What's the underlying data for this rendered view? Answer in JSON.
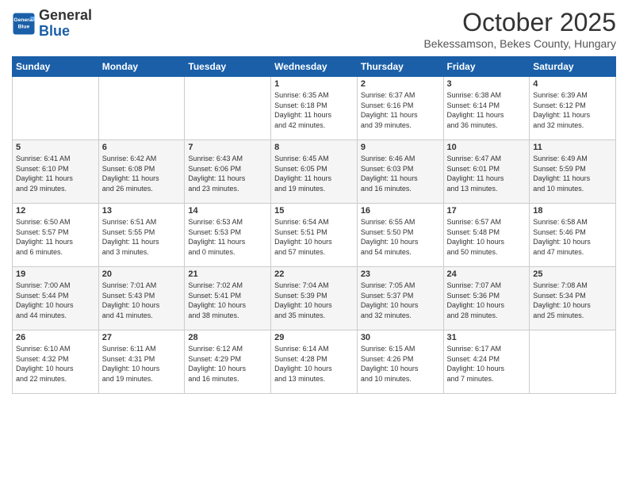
{
  "header": {
    "logo_general": "General",
    "logo_blue": "Blue",
    "month": "October 2025",
    "location": "Bekessamson, Bekes County, Hungary"
  },
  "days_of_week": [
    "Sunday",
    "Monday",
    "Tuesday",
    "Wednesday",
    "Thursday",
    "Friday",
    "Saturday"
  ],
  "weeks": [
    [
      {
        "day": "",
        "info": ""
      },
      {
        "day": "",
        "info": ""
      },
      {
        "day": "",
        "info": ""
      },
      {
        "day": "1",
        "info": "Sunrise: 6:35 AM\nSunset: 6:18 PM\nDaylight: 11 hours\nand 42 minutes."
      },
      {
        "day": "2",
        "info": "Sunrise: 6:37 AM\nSunset: 6:16 PM\nDaylight: 11 hours\nand 39 minutes."
      },
      {
        "day": "3",
        "info": "Sunrise: 6:38 AM\nSunset: 6:14 PM\nDaylight: 11 hours\nand 36 minutes."
      },
      {
        "day": "4",
        "info": "Sunrise: 6:39 AM\nSunset: 6:12 PM\nDaylight: 11 hours\nand 32 minutes."
      }
    ],
    [
      {
        "day": "5",
        "info": "Sunrise: 6:41 AM\nSunset: 6:10 PM\nDaylight: 11 hours\nand 29 minutes."
      },
      {
        "day": "6",
        "info": "Sunrise: 6:42 AM\nSunset: 6:08 PM\nDaylight: 11 hours\nand 26 minutes."
      },
      {
        "day": "7",
        "info": "Sunrise: 6:43 AM\nSunset: 6:06 PM\nDaylight: 11 hours\nand 23 minutes."
      },
      {
        "day": "8",
        "info": "Sunrise: 6:45 AM\nSunset: 6:05 PM\nDaylight: 11 hours\nand 19 minutes."
      },
      {
        "day": "9",
        "info": "Sunrise: 6:46 AM\nSunset: 6:03 PM\nDaylight: 11 hours\nand 16 minutes."
      },
      {
        "day": "10",
        "info": "Sunrise: 6:47 AM\nSunset: 6:01 PM\nDaylight: 11 hours\nand 13 minutes."
      },
      {
        "day": "11",
        "info": "Sunrise: 6:49 AM\nSunset: 5:59 PM\nDaylight: 11 hours\nand 10 minutes."
      }
    ],
    [
      {
        "day": "12",
        "info": "Sunrise: 6:50 AM\nSunset: 5:57 PM\nDaylight: 11 hours\nand 6 minutes."
      },
      {
        "day": "13",
        "info": "Sunrise: 6:51 AM\nSunset: 5:55 PM\nDaylight: 11 hours\nand 3 minutes."
      },
      {
        "day": "14",
        "info": "Sunrise: 6:53 AM\nSunset: 5:53 PM\nDaylight: 11 hours\nand 0 minutes."
      },
      {
        "day": "15",
        "info": "Sunrise: 6:54 AM\nSunset: 5:51 PM\nDaylight: 10 hours\nand 57 minutes."
      },
      {
        "day": "16",
        "info": "Sunrise: 6:55 AM\nSunset: 5:50 PM\nDaylight: 10 hours\nand 54 minutes."
      },
      {
        "day": "17",
        "info": "Sunrise: 6:57 AM\nSunset: 5:48 PM\nDaylight: 10 hours\nand 50 minutes."
      },
      {
        "day": "18",
        "info": "Sunrise: 6:58 AM\nSunset: 5:46 PM\nDaylight: 10 hours\nand 47 minutes."
      }
    ],
    [
      {
        "day": "19",
        "info": "Sunrise: 7:00 AM\nSunset: 5:44 PM\nDaylight: 10 hours\nand 44 minutes."
      },
      {
        "day": "20",
        "info": "Sunrise: 7:01 AM\nSunset: 5:43 PM\nDaylight: 10 hours\nand 41 minutes."
      },
      {
        "day": "21",
        "info": "Sunrise: 7:02 AM\nSunset: 5:41 PM\nDaylight: 10 hours\nand 38 minutes."
      },
      {
        "day": "22",
        "info": "Sunrise: 7:04 AM\nSunset: 5:39 PM\nDaylight: 10 hours\nand 35 minutes."
      },
      {
        "day": "23",
        "info": "Sunrise: 7:05 AM\nSunset: 5:37 PM\nDaylight: 10 hours\nand 32 minutes."
      },
      {
        "day": "24",
        "info": "Sunrise: 7:07 AM\nSunset: 5:36 PM\nDaylight: 10 hours\nand 28 minutes."
      },
      {
        "day": "25",
        "info": "Sunrise: 7:08 AM\nSunset: 5:34 PM\nDaylight: 10 hours\nand 25 minutes."
      }
    ],
    [
      {
        "day": "26",
        "info": "Sunrise: 6:10 AM\nSunset: 4:32 PM\nDaylight: 10 hours\nand 22 minutes."
      },
      {
        "day": "27",
        "info": "Sunrise: 6:11 AM\nSunset: 4:31 PM\nDaylight: 10 hours\nand 19 minutes."
      },
      {
        "day": "28",
        "info": "Sunrise: 6:12 AM\nSunset: 4:29 PM\nDaylight: 10 hours\nand 16 minutes."
      },
      {
        "day": "29",
        "info": "Sunrise: 6:14 AM\nSunset: 4:28 PM\nDaylight: 10 hours\nand 13 minutes."
      },
      {
        "day": "30",
        "info": "Sunrise: 6:15 AM\nSunset: 4:26 PM\nDaylight: 10 hours\nand 10 minutes."
      },
      {
        "day": "31",
        "info": "Sunrise: 6:17 AM\nSunset: 4:24 PM\nDaylight: 10 hours\nand 7 minutes."
      },
      {
        "day": "",
        "info": ""
      }
    ]
  ]
}
